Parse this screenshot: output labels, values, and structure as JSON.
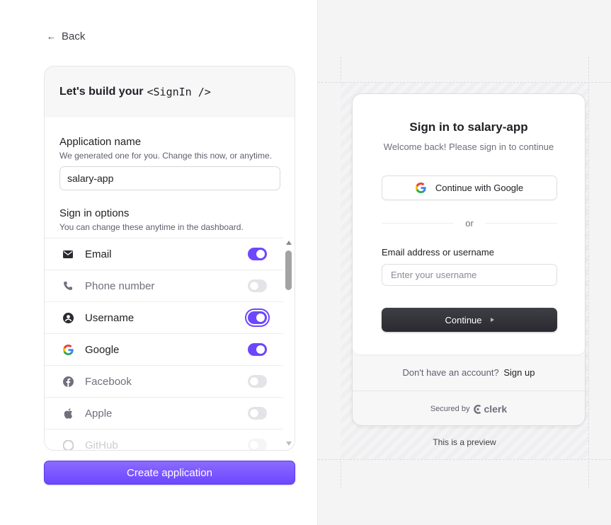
{
  "back": {
    "label": "Back",
    "icon": "arrow-left-icon"
  },
  "builder": {
    "title_prefix": "Let's build your",
    "title_code": "<SignIn />",
    "app_name": {
      "title": "Application name",
      "subtitle": "We generated one for you. Change this now, or anytime.",
      "value": "salary-app"
    },
    "sign_in_options": {
      "title": "Sign in options",
      "subtitle": "You can change these anytime in the dashboard."
    },
    "options": [
      {
        "label": "Email",
        "icon": "mail-icon",
        "enabled": true
      },
      {
        "label": "Phone number",
        "icon": "phone-icon",
        "enabled": false
      },
      {
        "label": "Username",
        "icon": "user-circle-icon",
        "enabled": true
      },
      {
        "label": "Google",
        "icon": "google-icon",
        "enabled": true
      },
      {
        "label": "Facebook",
        "icon": "facebook-icon",
        "enabled": false
      },
      {
        "label": "Apple",
        "icon": "apple-icon",
        "enabled": false
      },
      {
        "label": "GitHub",
        "icon": "github-icon",
        "enabled": false
      }
    ],
    "create_button": "Create application"
  },
  "preview": {
    "title": "Sign in to salary-app",
    "subtitle": "Welcome back! Please sign in to continue",
    "google_button": "Continue with Google",
    "divider": "or",
    "email_label": "Email address or username",
    "email_placeholder": "Enter your username",
    "continue_button": "Continue",
    "no_account": "Don't have an account?",
    "sign_up": "Sign up",
    "secured_by": "Secured by",
    "brand": "clerk",
    "note": "This is a preview"
  },
  "colors": {
    "accent": "#6c47ff",
    "dark_button": "#2f2f35",
    "panel_bg": "#f4f4f5"
  }
}
